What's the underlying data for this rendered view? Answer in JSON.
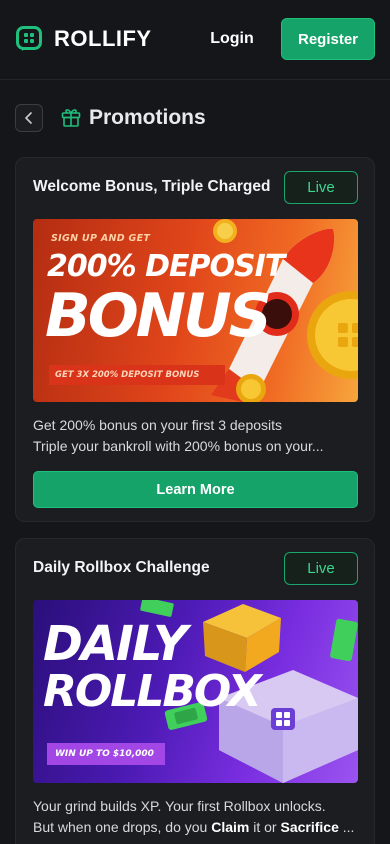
{
  "header": {
    "brand": "ROLLIFY",
    "login_label": "Login",
    "register_label": "Register"
  },
  "page": {
    "title": "Promotions",
    "back_icon": "chevron-left-icon",
    "title_icon": "gift-icon"
  },
  "colors": {
    "background": "#151619",
    "card": "#1b1d21",
    "accent": "#16a36a",
    "live_text": "#3fd68f"
  },
  "promotions": [
    {
      "title": "Welcome Bonus, Triple Charged",
      "status": "Live",
      "banner": {
        "kicker": "SIGN UP AND GET",
        "headline_line1": "200% DEPOSIT",
        "headline_line2": "BONUS",
        "strip": "GET 3X 200% DEPOSIT BONUS"
      },
      "desc_line1": "Get 200% bonus on your first 3 deposits",
      "desc_line2": "Triple your bankroll with 200% bonus on your...",
      "cta": "Learn More"
    },
    {
      "title": "Daily Rollbox Challenge",
      "status": "Live",
      "banner": {
        "headline_line1": "DAILY",
        "headline_line2": "ROLLBOX",
        "strip": "WIN UP TO $10,000"
      },
      "desc_line1": "Your grind builds XP. Your first Rollbox unlocks.",
      "desc_line2_pre": "But when one drops, do you ",
      "desc_line2_b1": "Claim",
      "desc_line2_mid": " it or ",
      "desc_line2_b2": "Sacrifice",
      "desc_line2_post": " ..."
    }
  ]
}
